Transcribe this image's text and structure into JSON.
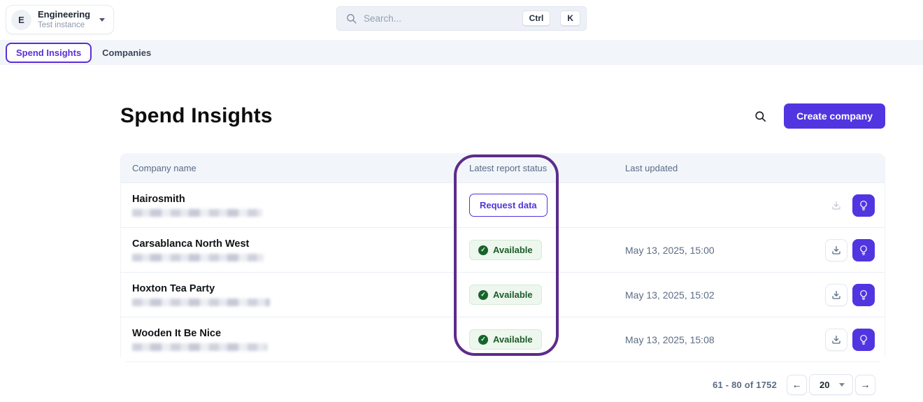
{
  "topbar": {
    "org": {
      "initial": "E",
      "name": "Engineering",
      "subtitle": "Test instance"
    },
    "search": {
      "placeholder": "Search...",
      "shortcut": [
        "Ctrl",
        "K"
      ]
    }
  },
  "nav": {
    "tabs": [
      {
        "label": "Spend Insights",
        "active": true
      },
      {
        "label": "Companies",
        "active": false
      }
    ]
  },
  "main": {
    "title": "Spend Insights",
    "create_button_label": "Create company"
  },
  "table": {
    "columns": {
      "name": "Company name",
      "status": "Latest report status",
      "updated": "Last updated"
    },
    "rows": [
      {
        "name": "Hairosmith",
        "status": "Request data",
        "status_type": "request",
        "updated": ""
      },
      {
        "name": "Carsablanca North West",
        "status": "Available",
        "status_type": "available",
        "updated": "May 13, 2025, 15:00"
      },
      {
        "name": "Hoxton Tea Party",
        "status": "Available",
        "status_type": "available",
        "updated": "May 13, 2025, 15:02"
      },
      {
        "name": "Wooden It Be Nice",
        "status": "Available",
        "status_type": "available",
        "updated": "May 13, 2025, 15:08"
      }
    ],
    "check_glyph": "✓"
  },
  "pagination": {
    "range_text": "61 - 80 of 1752",
    "page_size": "20",
    "prev": "←",
    "next": "→"
  },
  "colors": {
    "accent": "#5135e0",
    "annotation": "#5e2b8a",
    "available_green": "#1d5c28",
    "nav_bg": "#f2f6fa"
  },
  "icons": {
    "search": "magnifier",
    "download": "tray-down-arrow",
    "insights": "lightbulb",
    "check": "check-circle",
    "caret": "chevron-down"
  }
}
